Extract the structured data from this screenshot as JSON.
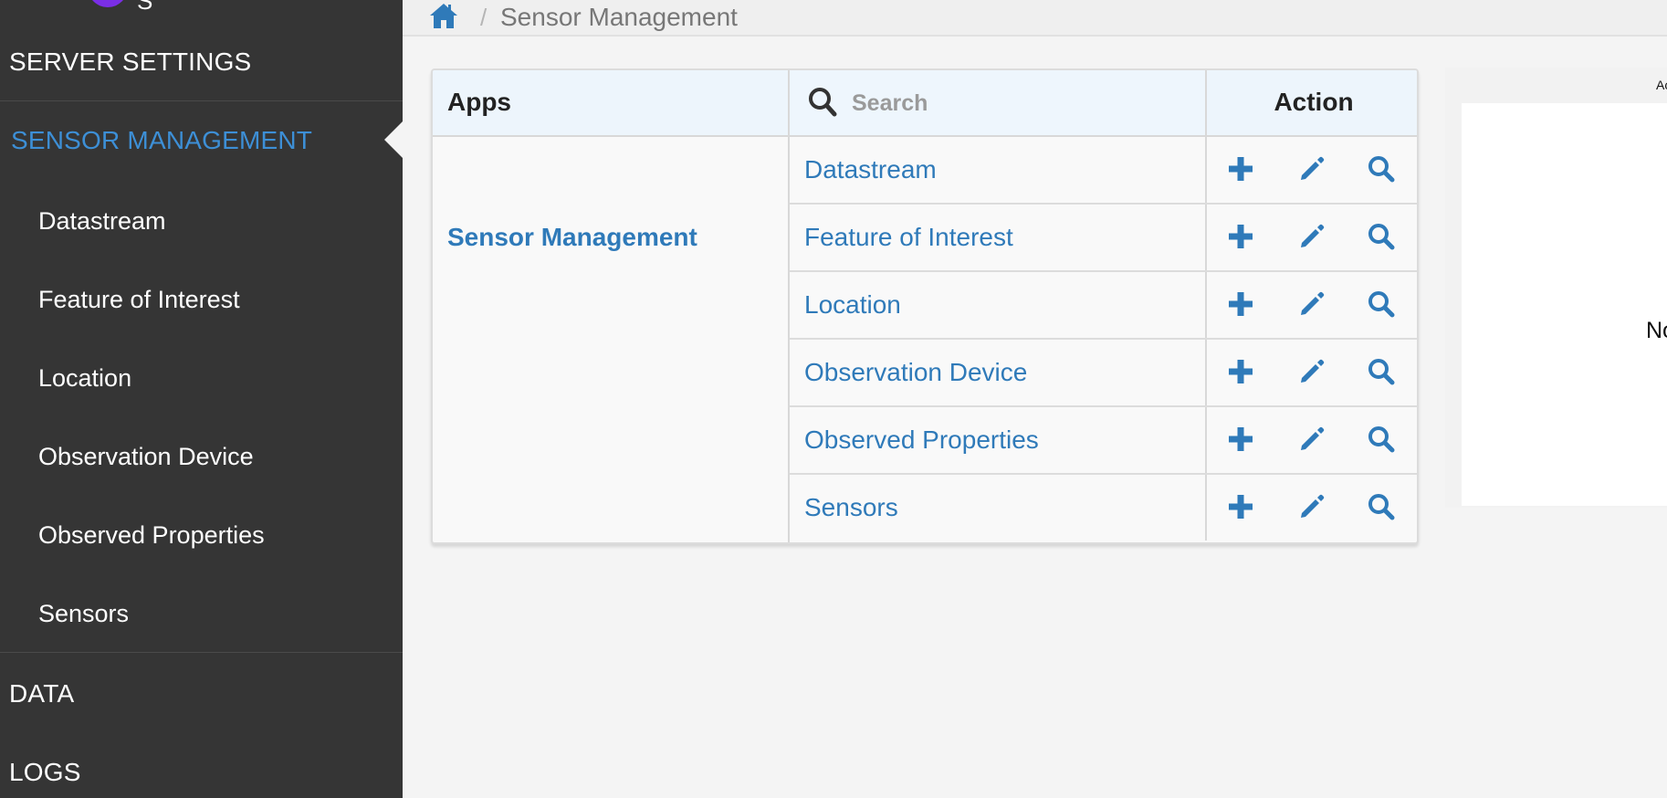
{
  "sidebar": {
    "logo_text": "S",
    "sections": [
      {
        "label": "SERVER SETTINGS"
      },
      {
        "label": "SENSOR MANAGEMENT"
      },
      {
        "label": "DATA"
      },
      {
        "label": "LOGS"
      }
    ],
    "items": [
      {
        "label": "Datastream"
      },
      {
        "label": "Feature of Interest"
      },
      {
        "label": "Location"
      },
      {
        "label": "Observation Device"
      },
      {
        "label": "Observed Properties"
      },
      {
        "label": "Sensors"
      }
    ]
  },
  "breadcrumb": {
    "separator": "/",
    "current": "Sensor Management"
  },
  "table": {
    "apps_header": "Apps",
    "search_placeholder": "Search",
    "action_header": "Action",
    "app_name": "Sensor Management",
    "rows": [
      {
        "label": "Datastream"
      },
      {
        "label": "Feature of Interest"
      },
      {
        "label": "Location"
      },
      {
        "label": "Observation Device"
      },
      {
        "label": "Observed Properties"
      },
      {
        "label": "Sensors"
      }
    ]
  },
  "side_panel": {
    "heading": "Ac",
    "message": "No"
  },
  "colors": {
    "sidebar_bg": "#353535",
    "accent": "#2f7ab9",
    "active_section": "#3d8fd6",
    "logo": "#7a2ee6"
  },
  "icons": [
    "home-icon",
    "search-icon",
    "plus-icon",
    "pencil-icon",
    "magnifier-icon"
  ]
}
